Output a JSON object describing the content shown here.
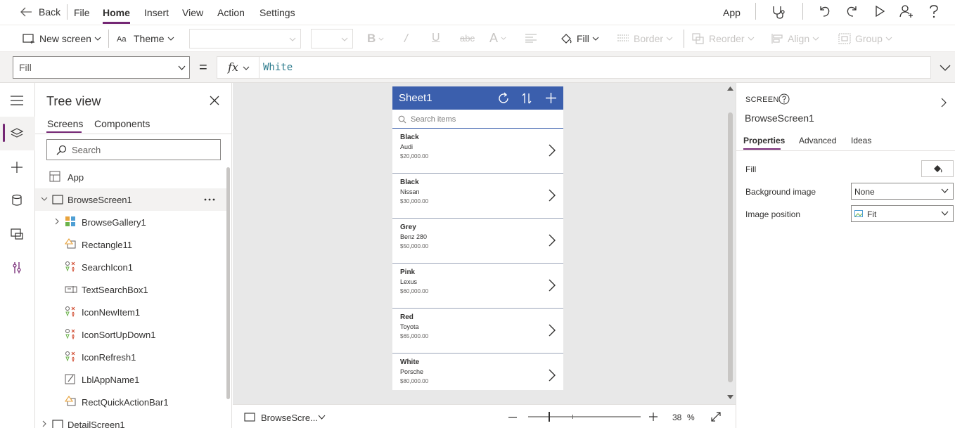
{
  "menubar": {
    "back_label": "Back",
    "items": [
      "File",
      "Home",
      "Insert",
      "View",
      "Action",
      "Settings"
    ],
    "active_item": "Home",
    "right_label": "App"
  },
  "ribbon": {
    "new_screen": "New screen",
    "theme": "Theme",
    "fill": "Fill",
    "border": "Border",
    "reorder": "Reorder",
    "align": "Align",
    "group": "Group"
  },
  "formula": {
    "property": "Fill",
    "equals": "=",
    "fx": "fx",
    "value": "White"
  },
  "tree": {
    "title": "Tree view",
    "tabs": [
      "Screens",
      "Components"
    ],
    "search_placeholder": "Search",
    "app_label": "App",
    "nodes": [
      {
        "label": "BrowseScreen1",
        "icon": "screen-icon",
        "level": 0
      },
      {
        "label": "BrowseGallery1",
        "icon": "gallery-icon",
        "level": 1
      },
      {
        "label": "Rectangle11",
        "icon": "shape-icon",
        "level": 1
      },
      {
        "label": "SearchIcon1",
        "icon": "icon-control-icon",
        "level": 1
      },
      {
        "label": "TextSearchBox1",
        "icon": "textinput-icon",
        "level": 1
      },
      {
        "label": "IconNewItem1",
        "icon": "icon-control-icon",
        "level": 1
      },
      {
        "label": "IconSortUpDown1",
        "icon": "icon-control-icon",
        "level": 1
      },
      {
        "label": "IconRefresh1",
        "icon": "icon-control-icon",
        "level": 1
      },
      {
        "label": "LblAppName1",
        "icon": "label-icon",
        "level": 1
      },
      {
        "label": "RectQuickActionBar1",
        "icon": "shape-icon",
        "level": 1
      },
      {
        "label": "DetailScreen1",
        "icon": "screen-icon",
        "level": 0
      }
    ]
  },
  "phone": {
    "title": "Sheet1",
    "search_placeholder": "Search items",
    "items": [
      {
        "title": "Black",
        "subtitle": "Audi",
        "body": "$20,000.00"
      },
      {
        "title": "Black",
        "subtitle": "Nissan",
        "body": "$30,000.00"
      },
      {
        "title": "Grey",
        "subtitle": "Benz 280",
        "body": "$50,000.00"
      },
      {
        "title": "Pink",
        "subtitle": "Lexus",
        "body": "$60,000.00"
      },
      {
        "title": "Red",
        "subtitle": "Toyota",
        "body": "$65,000.00"
      },
      {
        "title": "White",
        "subtitle": "Porsche",
        "body": "$80,000.00"
      }
    ],
    "header_color": "#3b5fad"
  },
  "statusbar": {
    "screen": "BrowseScre...",
    "zoom": "38",
    "zoom_unit": "%"
  },
  "properties": {
    "kind": "SCREEN",
    "name": "BrowseScreen1",
    "tabs": [
      "Properties",
      "Advanced",
      "Ideas"
    ],
    "fill_label": "Fill",
    "bg_image_label": "Background image",
    "bg_image_value": "None",
    "img_pos_label": "Image position",
    "img_pos_value": "Fit"
  },
  "accent_color": "#742774"
}
